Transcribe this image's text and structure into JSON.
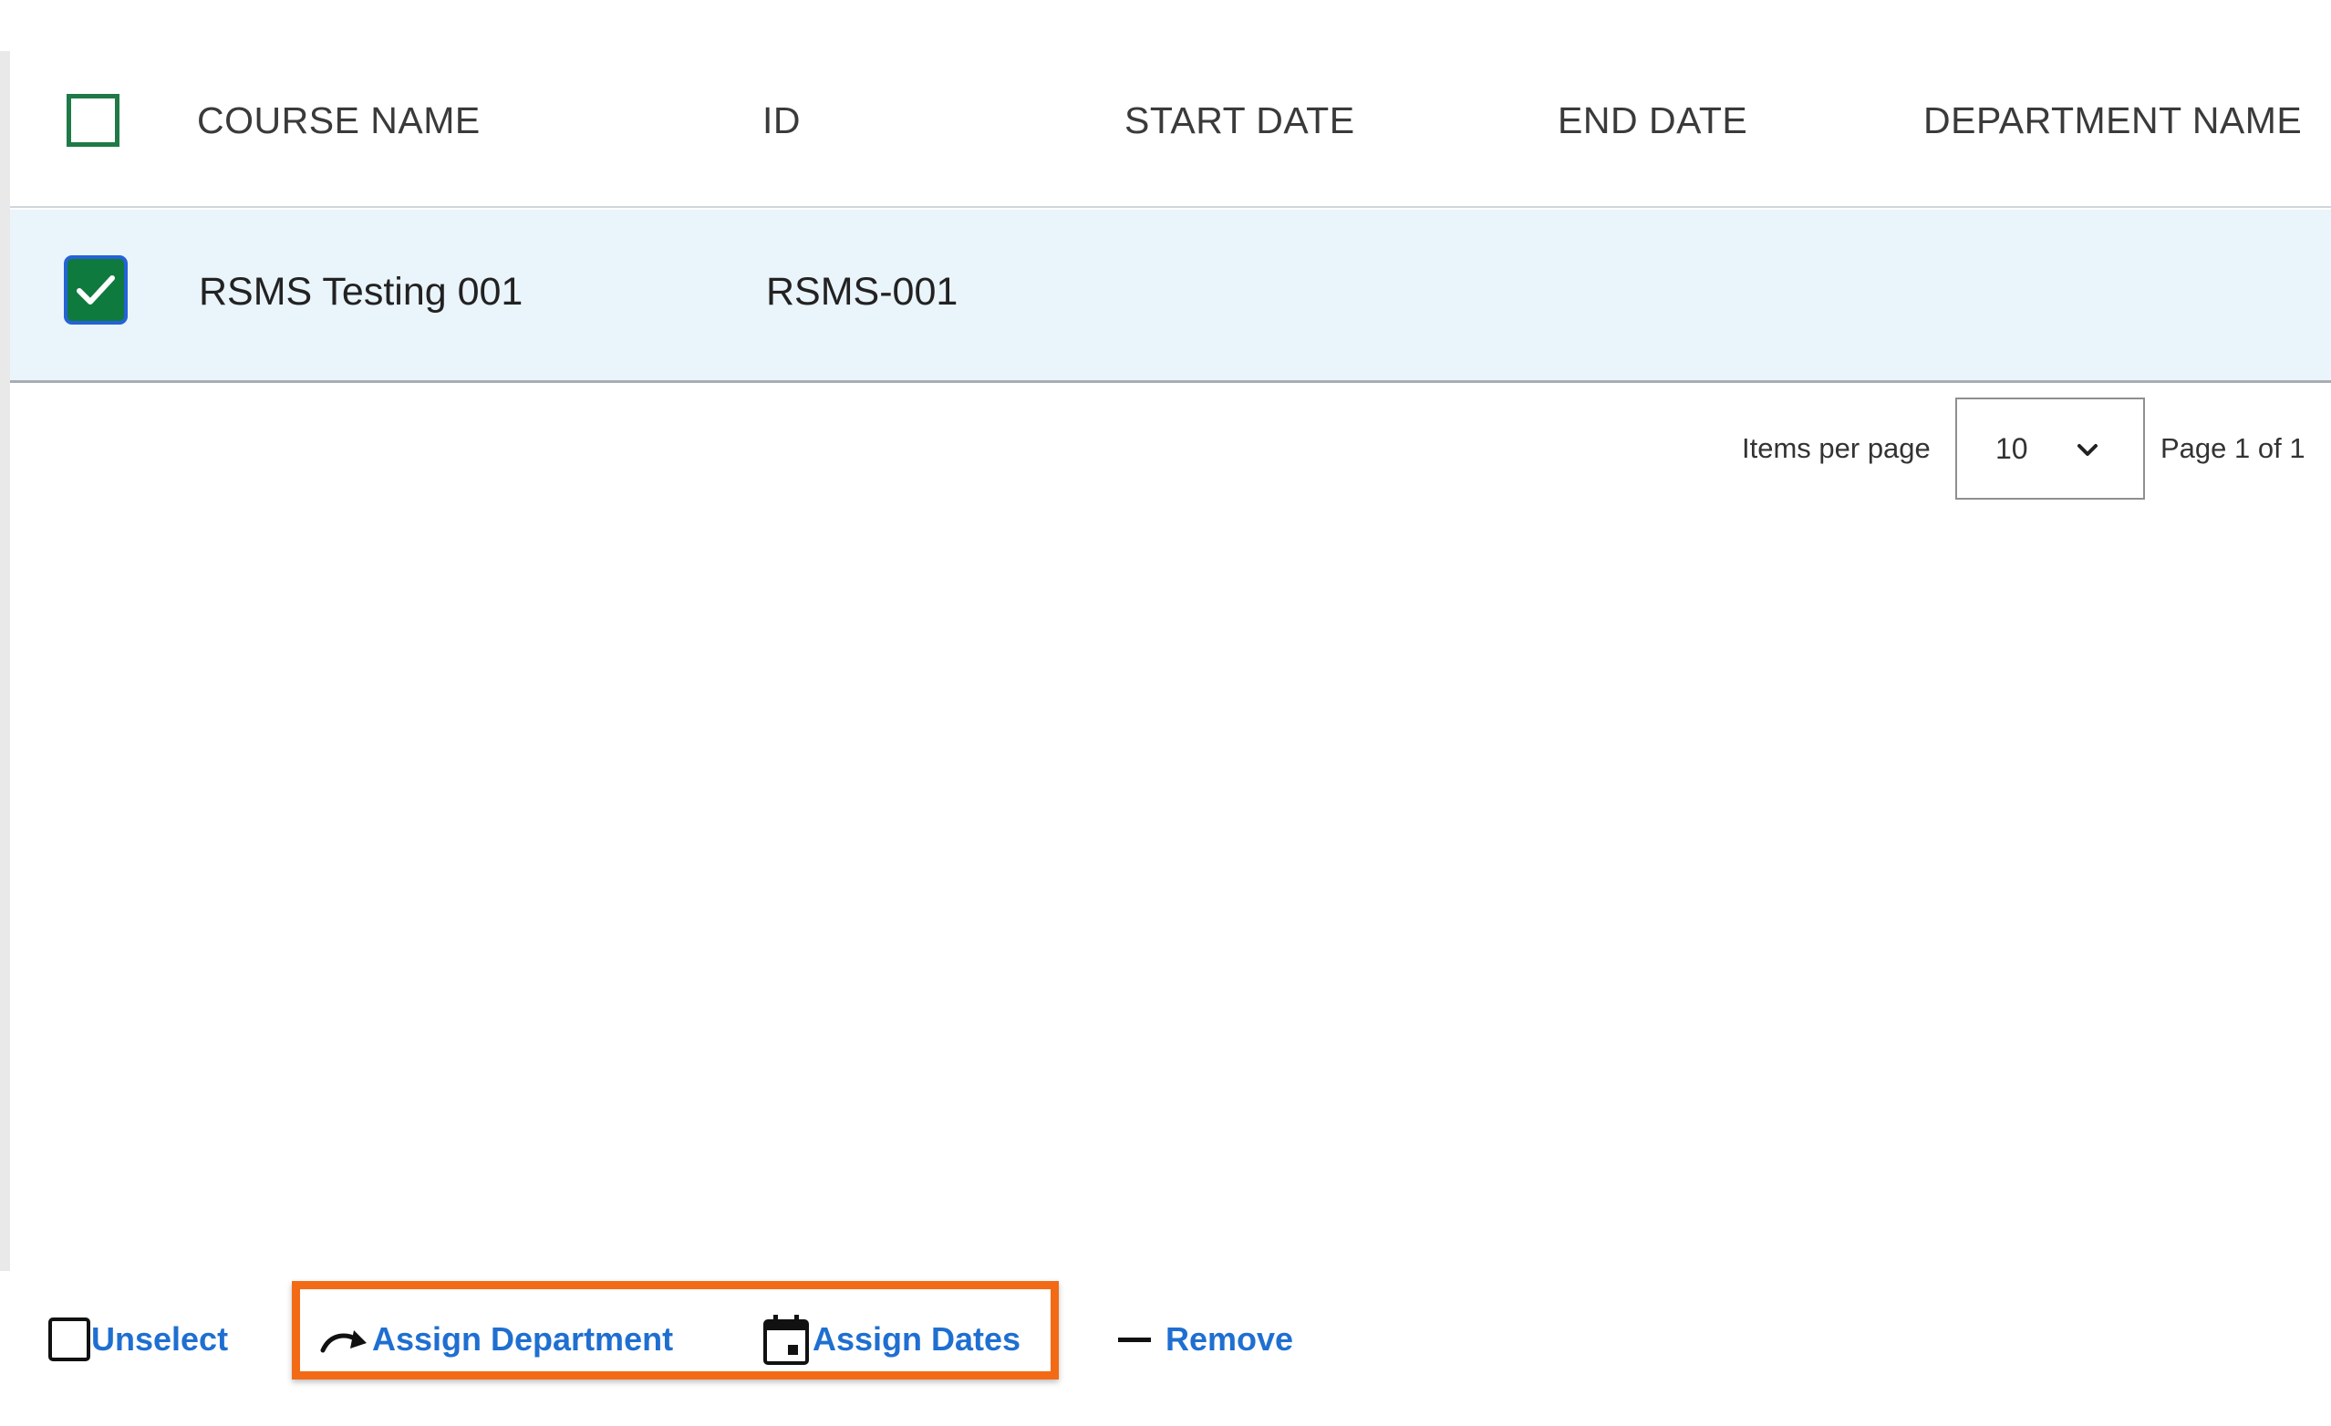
{
  "table": {
    "columns": {
      "course_name": "COURSE NAME",
      "id": "ID",
      "start_date": "START DATE",
      "end_date": "END DATE",
      "department_name": "DEPARTMENT NAME"
    },
    "rows": [
      {
        "selected": true,
        "course_name": "RSMS Testing 001",
        "id": "RSMS-001",
        "start_date": "",
        "end_date": "",
        "department_name": ""
      }
    ]
  },
  "pagination": {
    "items_per_page_label": "Items per page",
    "items_per_page_value": "10",
    "page_status": "Page 1 of 1"
  },
  "actions": {
    "unselect": "Unselect",
    "assign_department": "Assign Department",
    "assign_dates": "Assign Dates",
    "remove": "Remove"
  },
  "colors": {
    "link_blue": "#1f6fd1",
    "checkbox_green": "#0f7a3e",
    "selected_row_bg": "#eaf4fb",
    "highlight_orange": "#f26a16"
  },
  "icons": {
    "unselect": "checkbox-empty-icon",
    "assign_department": "redo-arrow-icon",
    "assign_dates": "calendar-icon",
    "remove": "minus-icon",
    "items_per_page": "chevron-down-icon"
  }
}
